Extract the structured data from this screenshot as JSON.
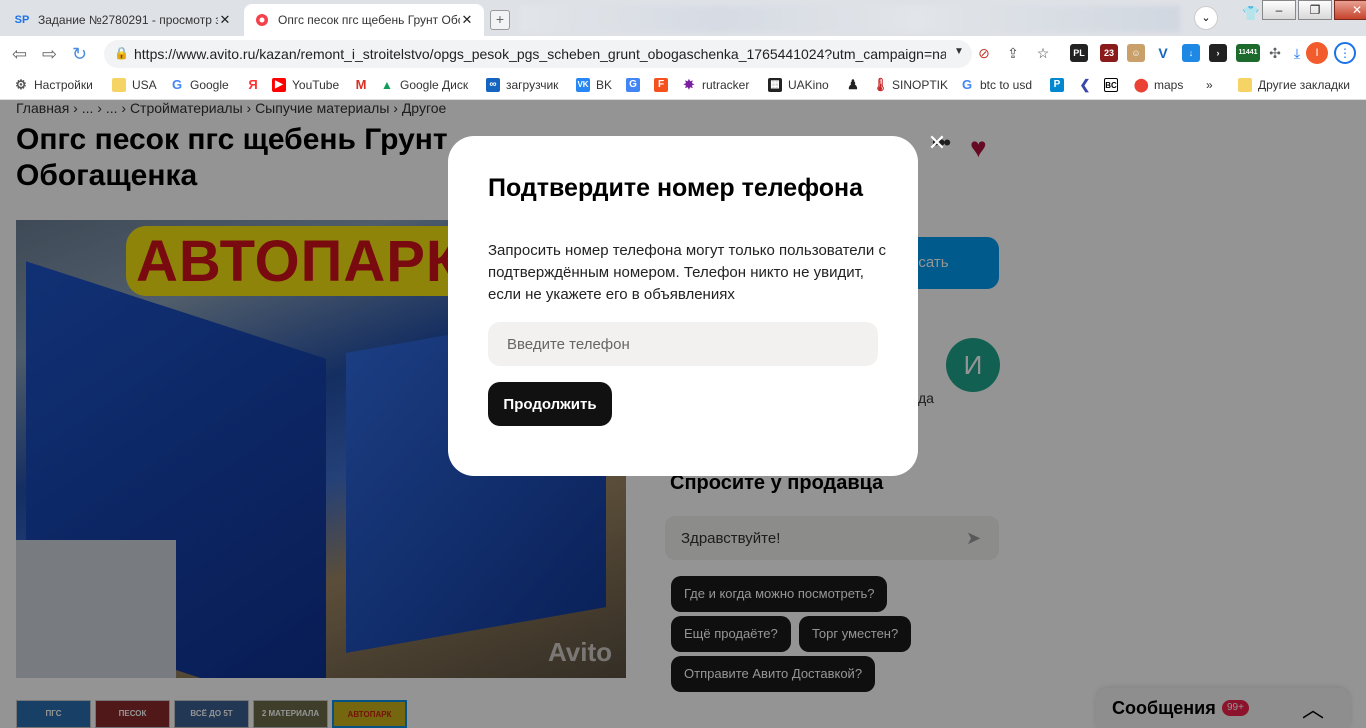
{
  "browser": {
    "tabs": [
      {
        "title": "Задание №2780291 - просмотр за",
        "favicon": "SP"
      },
      {
        "title": "Опгс песок пгс щебень Грунт Обо"
      }
    ],
    "new_tab": "+",
    "url": "https://www.avito.ru/kazan/remont_i_stroitelstvo/opgs_pesok_pgs_scheben_grunt_obogaschenka_1765441024?utm_campaign=nat...",
    "extension_badges": {
      "pl": "PL",
      "n23": "23",
      "n11441": "11441"
    },
    "profile_letter": "I",
    "bookmarks": [
      "Настройки",
      "USA",
      "Google",
      "YouTube",
      "Google Диск",
      "загрузчик",
      "BK",
      "rutracker",
      "UAKino",
      "SINOPTIK",
      "btc to usd",
      "maps",
      "Другие закладки"
    ]
  },
  "page": {
    "breadcrumb": "Главная › ... › ... › Стройматериалы › Сыпучие материалы › Другое",
    "title": "Опгс песок пгс щебень Грунт Обогащенка",
    "photo_banner": "АВТОПАРК",
    "photo_watermark": "Avito",
    "thumbs": [
      "ПГС",
      "ПЕСОК",
      "ВСЁ ДО 5Т",
      "2 МАТЕРИАЛА",
      "АВТОПАРК"
    ],
    "write_button": "исать",
    "seller_initial": "И",
    "seller_fragment": "да",
    "ask": {
      "title": "Спросите у продавца",
      "input_value": "Здравствуйте!",
      "chips": [
        "Где и когда можно посмотреть?",
        "Ещё продаёте?",
        "Торг уместен?",
        "Отправите Авито Доставкой?"
      ]
    },
    "messages": {
      "label": "Сообщения",
      "badge": "99+"
    }
  },
  "modal": {
    "title": "Подтвердите номер телефона",
    "description": "Запросить номер телефона могут только пользователи с подтверждённым номером. Телефон никто не увидит, если не укажете его в объявлениях",
    "phone_placeholder": "Введите телефон",
    "continue_label": "Продолжить"
  },
  "colors": {
    "accent": "#009cf0",
    "dark_button": "#111111",
    "favorite": "#b0123e",
    "badge": "#f1224b"
  }
}
